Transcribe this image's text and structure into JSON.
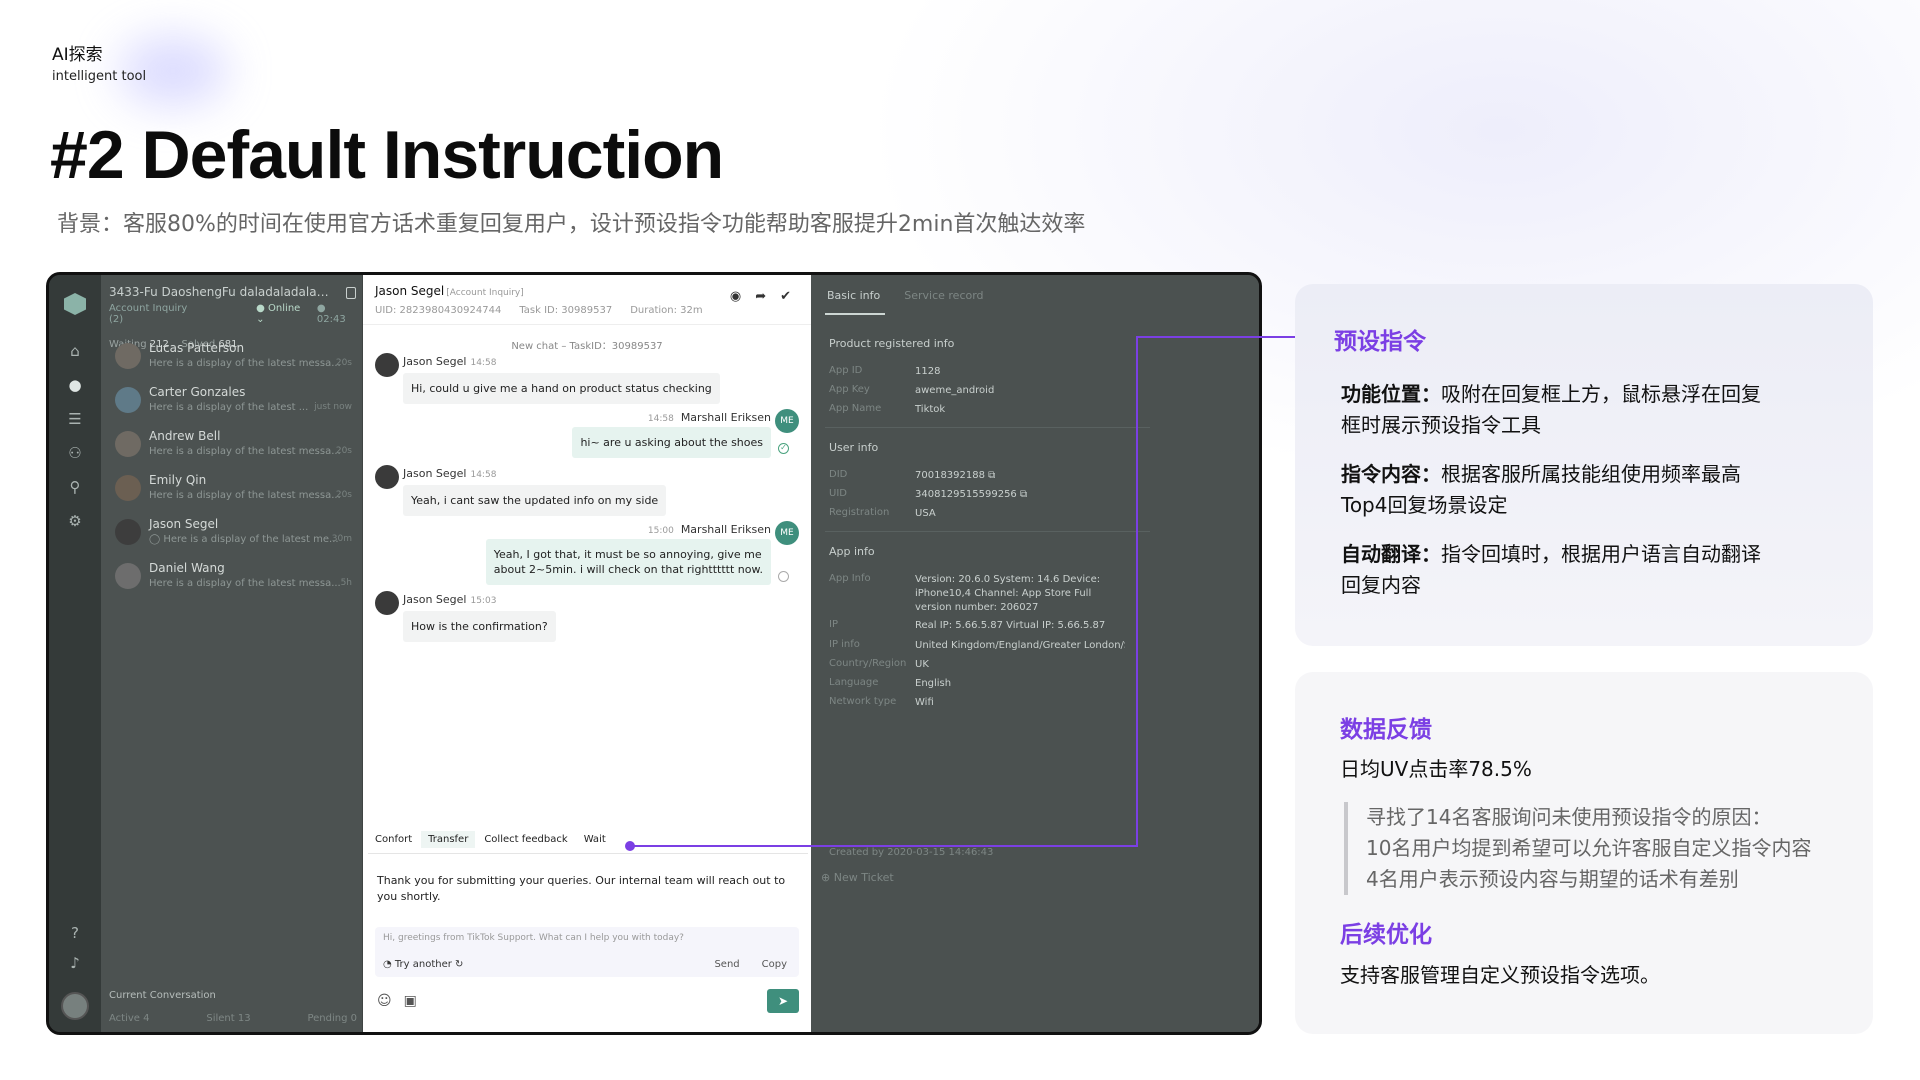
{
  "header": {
    "brand_cn": "AI探索",
    "brand_en": "intelligent tool",
    "title": "#2 Default Instruction",
    "subtitle": "背景：客服80%的时间在使用官方话术重复回复用户，设计预设指令功能帮助客服提升2min首次触达效率"
  },
  "app": {
    "nav_icons": [
      "home-icon",
      "chat-icon",
      "list-icon",
      "users-icon",
      "location-icon",
      "settings-icon",
      "help-icon",
      "bell-icon"
    ],
    "convlist": {
      "title": "3433-Fu DaoshengFu daladaladalada...",
      "queue": "Account Inquiry",
      "queue_count": "(2)",
      "status": "● Online ⌄",
      "timer": "● 02:43",
      "waiting_label": "Waiting",
      "waiting": "212",
      "solved_label": "Solved",
      "solved": "681",
      "items": [
        {
          "name": "Lucas Patterson",
          "msg": "Here is a display of the latest messa...",
          "time": "20s"
        },
        {
          "name": "Carter Gonzales",
          "msg": "Here is a display of the latest ...",
          "time": "just now"
        },
        {
          "name": "Andrew Bell",
          "msg": "Here is a display of the latest messa...",
          "time": "20s"
        },
        {
          "name": "Emily Qin",
          "msg": "Here is a display of the latest messa...",
          "time": "20s"
        },
        {
          "name": "Jason Segel",
          "msg": "◯ Here is a display of the latest me...",
          "time": "30m"
        },
        {
          "name": "Daniel Wang",
          "msg": "Here is a display of the latest messa...",
          "time": "5h"
        }
      ],
      "footer_title": "Current Conversation",
      "active": "Active 4",
      "silent": "Silent 13",
      "pending": "Pending 0"
    },
    "chat": {
      "name": "Jason Segel",
      "tag": "[Account Inquiry]",
      "uid": "UID: 2823980430924744",
      "task": "Task ID: 30989537",
      "duration": "Duration: 32m",
      "system": "New chat – TaskID：30989537",
      "messages": [
        {
          "from": "Jason Segel",
          "time": "14:58",
          "text": "Hi, could u give me a hand on product status checking"
        },
        {
          "from": "Marshall Eriksen",
          "time": "14:58",
          "text": "hi~ are u asking about the shoes",
          "avatar": "ME"
        },
        {
          "from": "Jason Segel",
          "time": "14:58",
          "text": "Yeah, i cant saw the updated info on my side"
        },
        {
          "from": "Marshall Eriksen",
          "time": "15:00",
          "text1": "Yeah, I got that, it must be so annoying, give me",
          "text2": "about 2~5min. i will check on that rightttttt now.",
          "avatar": "ME"
        },
        {
          "from": "Jason Segel",
          "time": "15:03",
          "text": "How is the confirmation?"
        }
      ],
      "quick_replies": [
        "Confort",
        "Transfer",
        "Collect feedback",
        "Wait"
      ],
      "compose_text": "Thank you for submitting your queries. Our internal team will reach out to you shortly.",
      "suggestion": "Hi, greetings from TikTok Support. What can I help you with today?",
      "try_another": "Try another ↻",
      "send": "Send",
      "copy": "Copy"
    },
    "info": {
      "tab_basic": "Basic info",
      "tab_service": "Service record",
      "product_title": "Product registered info",
      "product_rows": [
        {
          "k": "App ID",
          "v": "1128"
        },
        {
          "k": "App Key",
          "v": "aweme_android"
        },
        {
          "k": "App Name",
          "v": "Tiktok"
        }
      ],
      "user_title": "User info",
      "user_rows": [
        {
          "k": "DID",
          "v": "70018392188 ⧉"
        },
        {
          "k": "UID",
          "v": "3408129515599256 ⧉"
        },
        {
          "k": "Registration",
          "v": "USA"
        }
      ],
      "app_title": "App info",
      "app_rows": [
        {
          "k": "App Info",
          "v": "Version: 20.6.0 System: 14.6 Device: iPhone10,4 Channel: App Store Full version number: 206027"
        },
        {
          "k": "IP",
          "v": "Real IP: 5.66.5.87 Virtual IP: 5.66.5.87"
        },
        {
          "k": "IP info",
          "v": "United Kingdom/England/Greater London/Sl"
        },
        {
          "k": "Country/Region",
          "v": "UK"
        },
        {
          "k": "Language",
          "v": "English"
        },
        {
          "k": "Network type",
          "v": "Wifi"
        }
      ],
      "created": "Created by 2020-03-15 14:46:43",
      "new_ticket": "⊕ New Ticket"
    }
  },
  "annotations": {
    "card1_title": "预设指令",
    "p1_label": "功能位置：",
    "p1_text": "吸附在回复框上方，鼠标悬浮在回复框时展示预设指令工具",
    "p2_label": "指令内容：",
    "p2_text": "根据客服所属技能组使用频率最高Top4回复场景设定",
    "p3_label": "自动翻译：",
    "p3_text": "指令回填时，根据用户语言自动翻译回复内容",
    "data_title": "数据反馈",
    "data_value": "日均UV点击率78.5%",
    "quote1": "寻找了14名客服询问未使用预设指令的原因：",
    "quote2": "10名用户均提到希望可以允许客服自定义指令内容",
    "quote3": "4名用户表示预设内容与期望的话术有差别",
    "next_title": "后续优化",
    "next_text": "支持客服管理自定义预设指令选项。"
  },
  "colors": {
    "accent": "#7b3fe4",
    "brand_green": "#3f8f7d"
  }
}
